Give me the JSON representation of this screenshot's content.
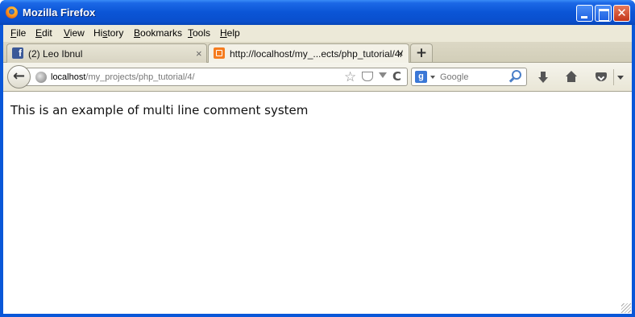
{
  "window": {
    "title": "Mozilla Firefox",
    "close_glyph": "✕"
  },
  "menubar": {
    "items": [
      {
        "acc": "F",
        "rest": "ile"
      },
      {
        "acc": "E",
        "rest": "dit"
      },
      {
        "acc": "V",
        "rest": "iew"
      },
      {
        "acc": "",
        "rest": "Hi",
        "acc2": "s",
        "rest2": "tory"
      },
      {
        "acc": "B",
        "rest": "ookmarks"
      },
      {
        "acc": "T",
        "rest": "ools"
      },
      {
        "acc": "H",
        "rest": "elp"
      }
    ]
  },
  "tabs": [
    {
      "label": "(2) Leo Ibnul",
      "icon": "facebook-icon",
      "icon_glyph": "f",
      "close_glyph": "×"
    },
    {
      "label": "http://localhost/my_...ects/php_tutorial/4/",
      "icon": "xampp-icon",
      "close_glyph": "×",
      "active": true
    }
  ],
  "new_tab_glyph": "+",
  "navbar": {
    "back_glyph": "←",
    "url_host": "localhost",
    "url_path": "/my_projects/php_tutorial/4/",
    "star_glyph": "☆",
    "reload_glyph": "C",
    "search_engine_glyph": "g",
    "search_placeholder": "Google"
  },
  "page": {
    "text": "This is an example of multi line comment system"
  },
  "colors": {
    "titlebar": "#0a57d8",
    "chrome": "#ece9d8"
  }
}
